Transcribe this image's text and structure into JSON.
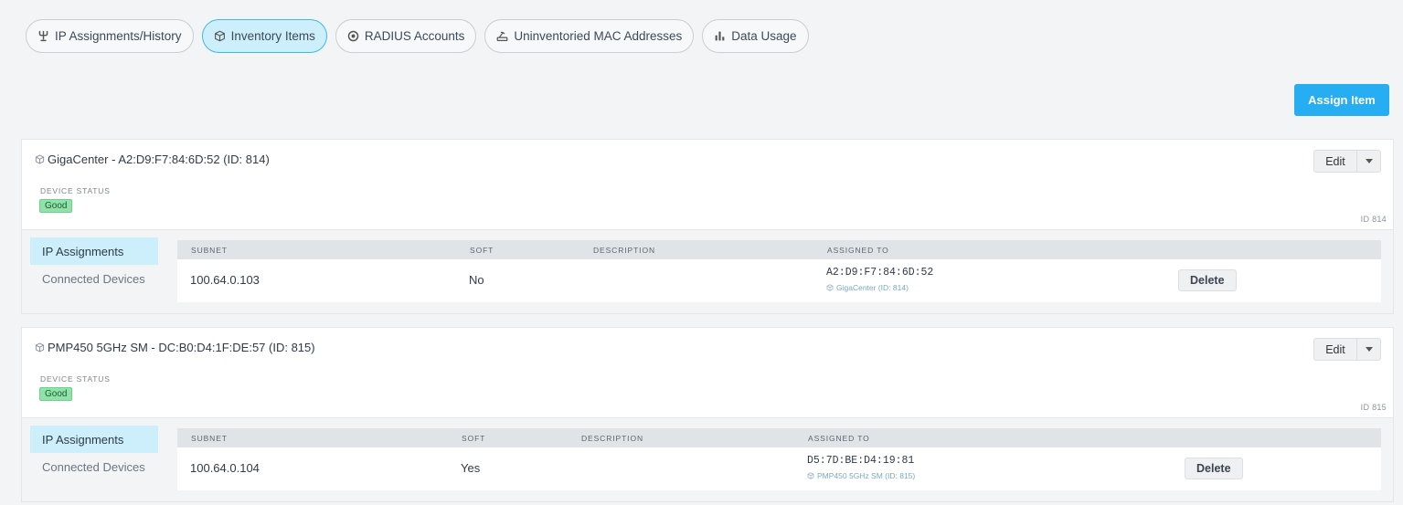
{
  "tabs": [
    {
      "label": "IP Assignments/History",
      "icon": "network-icon"
    },
    {
      "label": "Inventory Items",
      "icon": "box-icon"
    },
    {
      "label": "RADIUS Accounts",
      "icon": "target-icon"
    },
    {
      "label": "Uninventoried MAC Addresses",
      "icon": "router-icon"
    },
    {
      "label": "Data Usage",
      "icon": "bar-chart-icon"
    }
  ],
  "active_tab": "Inventory Items",
  "assign_button": "Assign Item",
  "colors": {
    "accent": "#26adf2",
    "active_tab_bg": "#cdeefb",
    "good_badge": "#8fe3a9"
  },
  "items": [
    {
      "title": "GigaCenter - A2:D9:F7:84:6D:52 (ID: 814)",
      "status_label": "DEVICE STATUS",
      "status": "Good",
      "edit_label": "Edit",
      "id_label": "ID 814",
      "side_tabs": [
        "IP Assignments",
        "Connected Devices"
      ],
      "columns": [
        "SUBNET",
        "SOFT",
        "DESCRIPTION",
        "ASSIGNED TO"
      ],
      "row": {
        "subnet": "100.64.0.103",
        "soft": "No",
        "description": "",
        "assigned_mac": "A2:D9:F7:84:6D:52",
        "assigned_device": "GigaCenter (ID: 814)",
        "delete_label": "Delete"
      }
    },
    {
      "title": "PMP450 5GHz SM - DC:B0:D4:1F:DE:57 (ID: 815)",
      "status_label": "DEVICE STATUS",
      "status": "Good",
      "edit_label": "Edit",
      "id_label": "ID 815",
      "side_tabs": [
        "IP Assignments",
        "Connected Devices"
      ],
      "columns": [
        "SUBNET",
        "SOFT",
        "DESCRIPTION",
        "ASSIGNED TO"
      ],
      "row": {
        "subnet": "100.64.0.104",
        "soft": "Yes",
        "description": "",
        "assigned_mac": "D5:7D:BE:D4:19:81",
        "assigned_device": "PMP450 5GHz SM (ID: 815)",
        "delete_label": "Delete"
      }
    }
  ]
}
